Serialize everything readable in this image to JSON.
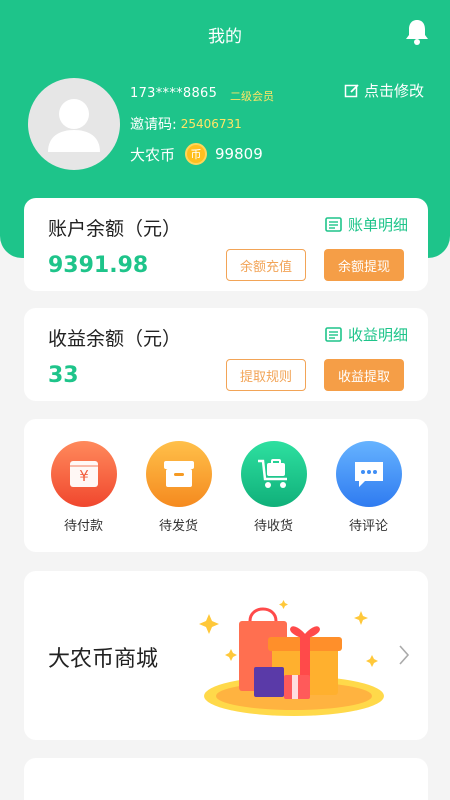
{
  "header": {
    "title": "我的",
    "bell_icon": "bell-icon",
    "edit_label": "点击修改"
  },
  "profile": {
    "phone": "173****8865",
    "level": "二级会员",
    "invite_label": "邀请码:",
    "invite_code": "25406731",
    "coin_label": "大农币",
    "coin_icon_text": "币",
    "coin_value": "99809"
  },
  "account": {
    "title": "账户余额（元）",
    "link": "账单明细",
    "amount": "9391.98",
    "btn_outline": "余额充值",
    "btn_fill": "余额提现"
  },
  "income": {
    "title": "收益余额（元）",
    "link": "收益明细",
    "amount": "33",
    "btn_outline": "提取规则",
    "btn_fill": "收益提取"
  },
  "orders": [
    {
      "label": "待付款",
      "icon": "wallet-icon",
      "color": "#f25e3d"
    },
    {
      "label": "待发货",
      "icon": "box-icon",
      "color": "#f59a23"
    },
    {
      "label": "待收货",
      "icon": "cart-icon",
      "color": "#17c78a"
    },
    {
      "label": "待评论",
      "icon": "chat-icon",
      "color": "#3f8ef5"
    }
  ],
  "banner": {
    "title": "大农币商城",
    "arrow_icon": "chevron-right-icon"
  },
  "colors": {
    "brand_green": "#1ec48a",
    "accent_orange": "#f59e47",
    "highlight_yellow": "#ffe566"
  }
}
